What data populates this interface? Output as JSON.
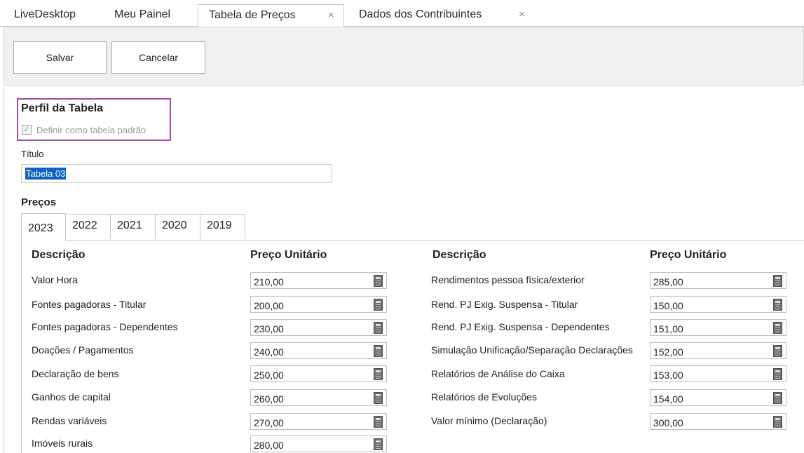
{
  "top_tabs": [
    {
      "label": "LiveDesktop"
    },
    {
      "label": "Meu Painel"
    },
    {
      "label": "Tabela de Preços",
      "close": "×"
    },
    {
      "label": "Dados dos Contribuintes",
      "close": "×"
    }
  ],
  "toolbar": {
    "save_label_u": "S",
    "save_label_rest": "alvar",
    "cancel_label_u": "C",
    "cancel_label_rest": "ancelar"
  },
  "profile": {
    "title": "Perfil da Tabela",
    "default_checkbox_label": "Definir como tabela padrão",
    "default_checked": true
  },
  "titulo": {
    "label": "Título",
    "value": "Tabela 03"
  },
  "precos": {
    "label": "Preços",
    "year_tabs": [
      "2023",
      "2022",
      "2021",
      "2020",
      "2019"
    ],
    "active_year": "2023",
    "col_description": "Descrição",
    "col_price": "Preço Unitário",
    "left": [
      {
        "desc": "Valor Hora",
        "price": "210,00"
      },
      {
        "desc": "Fontes pagadoras - Titular",
        "price": "200,00"
      },
      {
        "desc": "Fontes pagadoras - Dependentes",
        "price": "230,00"
      },
      {
        "desc": "Doações / Pagamentos",
        "price": "240,00"
      },
      {
        "desc": "Declaração de bens",
        "price": "250,00"
      },
      {
        "desc": "Ganhos de capital",
        "price": "260,00"
      },
      {
        "desc": "Rendas variáveis",
        "price": "270,00"
      },
      {
        "desc": "Imóveis rurais",
        "price": "280,00"
      }
    ],
    "right": [
      {
        "desc": "Rendimentos pessoa física/exterior",
        "price": "285,00"
      },
      {
        "desc": "Rend. PJ Exig. Suspensa - Titular",
        "price": "150,00"
      },
      {
        "desc": "Rend. PJ Exig. Suspensa - Dependentes",
        "price": "151,00"
      },
      {
        "desc": "Simulação Unificação/Separação Declarações",
        "price": "152,00"
      },
      {
        "desc": "Relatórios de Análise do Caixa",
        "price": "153,00"
      },
      {
        "desc": "Relatórios de Evoluções",
        "price": "154,00"
      },
      {
        "desc": "Valor mínimo (Declaração)",
        "price": "300,00"
      }
    ]
  },
  "colors": {
    "highlight_border": "#a349a4",
    "selection": "#0a63c7"
  },
  "icons": {
    "tab_close": "close-icon",
    "price_button": "calculator-icon",
    "checkbox": "checkbox-icon"
  }
}
